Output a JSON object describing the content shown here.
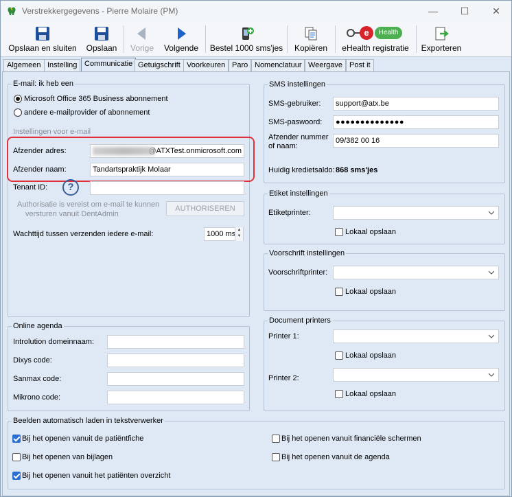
{
  "window": {
    "title": "Verstrekkergegevens - Pierre Molaire (PM)",
    "minimize": "—",
    "maximize": "☐",
    "close": "✕"
  },
  "toolbar": {
    "save_close": "Opslaan en sluiten",
    "save": "Opslaan",
    "previous": "Vorige",
    "next": "Volgende",
    "order_sms": "Bestel 1000 sms'jes",
    "copy": "Kopiëren",
    "ehealth": "eHealth registratie",
    "ehealth_logo_text": "Health",
    "export": "Exporteren"
  },
  "tabs": [
    "Algemeen",
    "Instelling",
    "Communicatie",
    "Getuigschrift",
    "Voorkeuren",
    "Paro",
    "Nomenclatuur",
    "Weergave",
    "Post it"
  ],
  "email": {
    "group_title": "E-mail: ik heb een",
    "option_office": "Microsoft Office 365 Business abonnement",
    "option_other": "andere e-mailprovider of abonnement",
    "settings_title": "Instellingen voor e-mail",
    "sender_address_label": "Afzender adres:",
    "sender_address_value": "@ATXTest.onmicrosoft.com",
    "sender_name_label": "Afzender naam:",
    "sender_name_value": "Tandartspraktijk Molaar",
    "tenant_label": "Tenant ID:",
    "tenant_value": "",
    "help_icon": "?",
    "auth_note_1": "Authorisatie is vereist om e-mail te kunnen",
    "auth_note_2": "versturen vanuit DentAdmin",
    "authorize_button": "AUTHORISEREN",
    "wait_label": "Wachttijd tussen verzenden iedere e-mail:",
    "wait_value": "1000 ms",
    "spin_up": "▲",
    "spin_down": "▼"
  },
  "agenda": {
    "group_title": "Online agenda",
    "introlution_label": "Introlution domeinnaam:",
    "dixys_label": "Dixys code:",
    "sanmax_label": "Sanmax code:",
    "mikrono_label": "Mikrono code:",
    "introlution_value": "",
    "dixys_value": "",
    "sanmax_value": "",
    "mikrono_value": ""
  },
  "sms": {
    "group_title": "SMS instellingen",
    "user_label": "SMS-gebruiker:",
    "user_value": "support@atx.be",
    "password_label": "SMS-paswoord:",
    "password_value": "●●●●●●●●●●●●●●",
    "sender_number_label_1": "Afzender nummer",
    "sender_number_label_2": "of naam:",
    "sender_number_value": "09/382 00 16",
    "credit_label": "Huidig kredietsaldo:",
    "credit_value": "868 sms'jes"
  },
  "label_settings": {
    "group_title": "Etiket instellingen",
    "printer_label": "Etiketprinter:",
    "local_save": "Lokaal opslaan"
  },
  "prescription": {
    "group_title": "Voorschrift instellingen",
    "printer_label": "Voorschriftprinter:",
    "local_save": "Lokaal opslaan"
  },
  "doc_printers": {
    "group_title": "Document printers",
    "printer1_label": "Printer 1:",
    "printer2_label": "Printer 2:",
    "local_save_1": "Lokaal opslaan",
    "local_save_2": "Lokaal opslaan"
  },
  "images": {
    "group_title": "Beelden automatisch laden in tekstverwerker",
    "opt1": "Bij het openen vanuit de patiëntfiche",
    "opt2": "Bij het openen van bijlagen",
    "opt3": "Bij het openen vanuit het patiënten overzicht",
    "opt4": "Bij het openen vanuit financiële schermen",
    "opt5": "Bij het openen vanuit de agenda",
    "opt1_checked": true,
    "opt2_checked": false,
    "opt3_checked": true,
    "opt4_checked": false,
    "opt5_checked": false
  },
  "colors": {
    "accent": "#2b6fd1",
    "highlight": "#e0303a",
    "ehealth_red": "#d8232a",
    "ehealth_green": "#4caf50"
  }
}
